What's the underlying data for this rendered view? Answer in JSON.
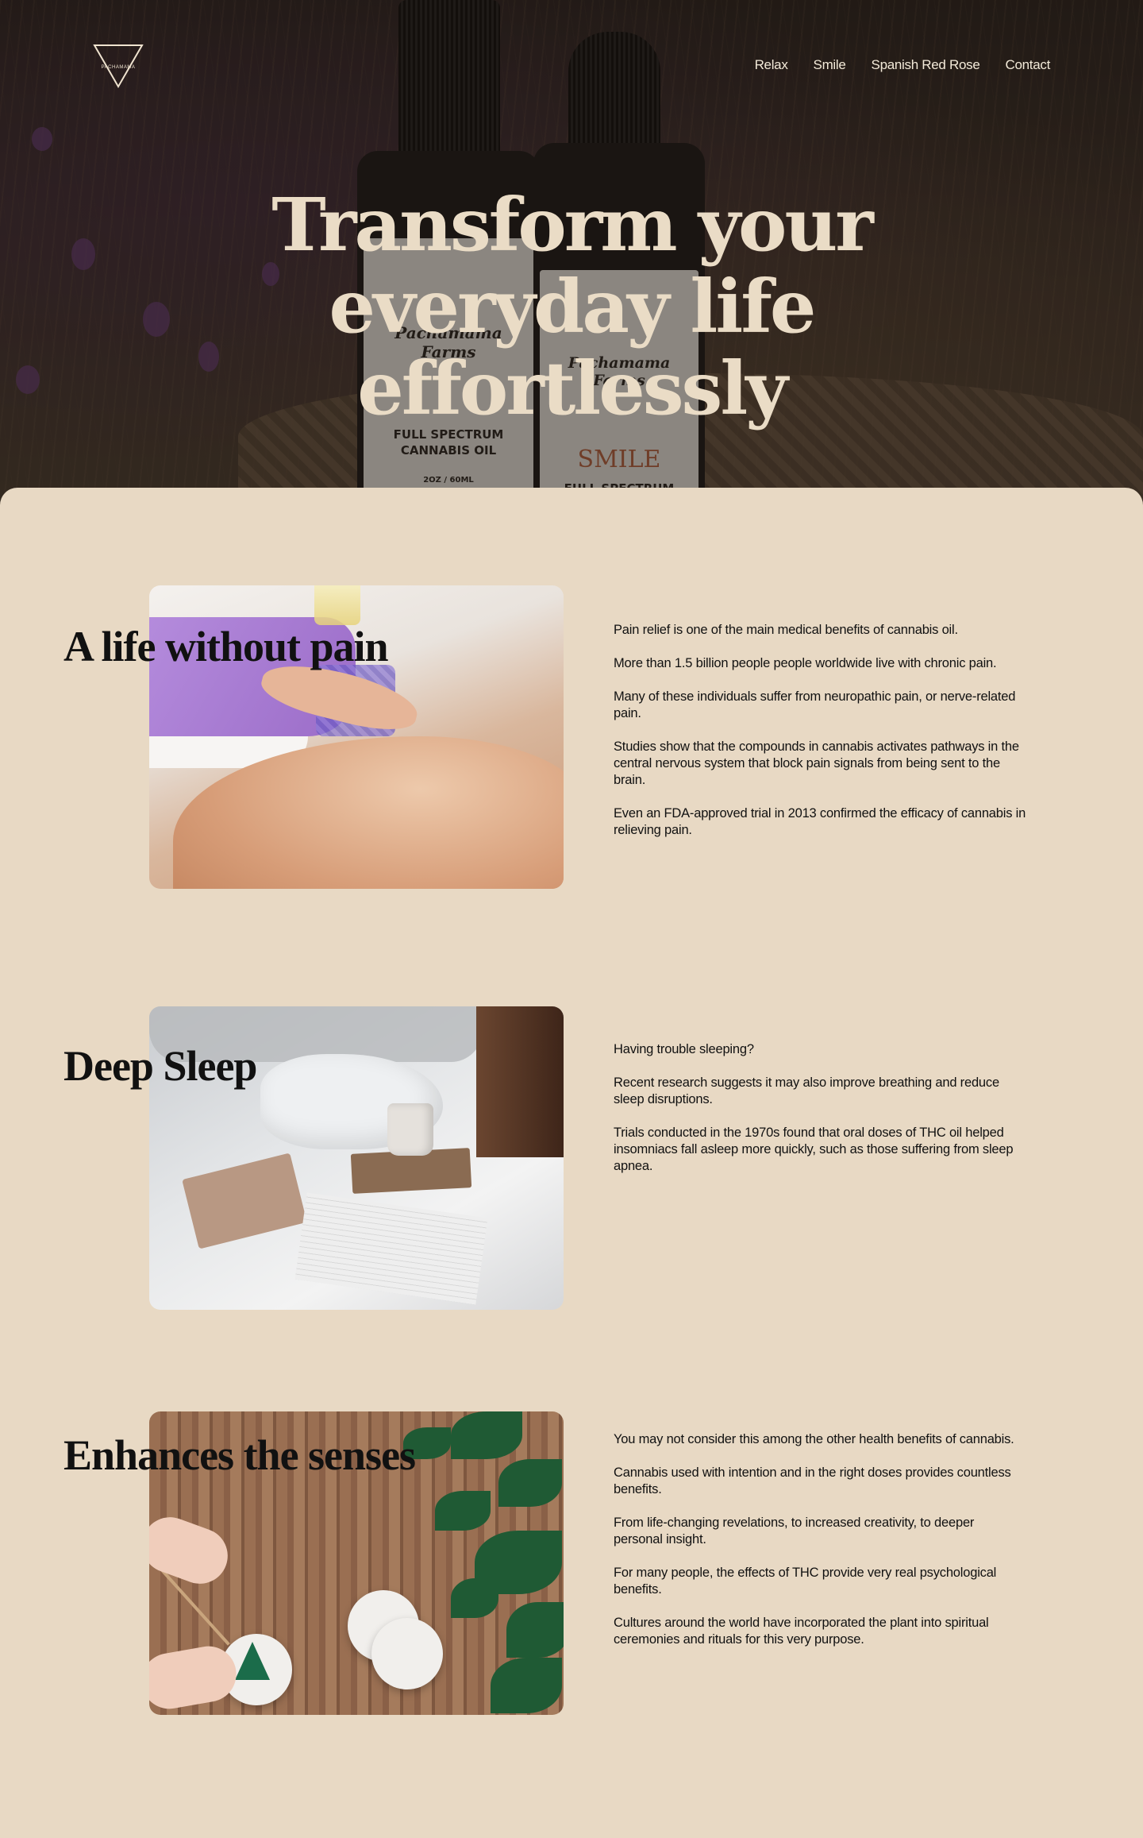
{
  "brand": {
    "logo_text": "PACHAMAMA"
  },
  "nav": {
    "items": [
      "Relax",
      "Smile",
      "Spanish Red Rose",
      "Contact"
    ]
  },
  "hero": {
    "title_lines": [
      "Transform your",
      "everyday life",
      "effortlessly"
    ],
    "bottle_left_label": [
      "Pachamama",
      "Farms",
      "FULL SPECTRUM",
      "CANNABIS OIL",
      "2OZ / 60ML"
    ],
    "bottle_right_label": [
      "Pachamama",
      "Farms",
      "SMILE",
      "FULL SPECTRUM"
    ]
  },
  "sections": [
    {
      "title": "A life without pain",
      "image": "massage-photo",
      "paragraphs": [
        "Pain relief is one of the main medical benefits of cannabis oil.",
        "More than 1.5 billion people people worldwide live with chronic pain.",
        "Many of these individuals suffer from neuropathic pain, or nerve-related pain.",
        "Studies show that the compounds in cannabis activates pathways in the central nervous system that block pain signals from being sent to the brain.",
        "Even an FDA-approved trial in 2013 confirmed the efficacy of cannabis in relieving pain."
      ]
    },
    {
      "title": "Deep Sleep",
      "image": "bed-photo",
      "paragraphs": [
        "Having trouble sleeping?",
        "Recent research suggests it may also improve breathing and reduce sleep disruptions.",
        "Trials conducted in the 1970s found that oral doses of THC oil helped insomniacs fall asleep more quickly, such as those suffering from sleep apnea."
      ]
    },
    {
      "title": "Enhances the senses",
      "image": "wood-table-photo",
      "paragraphs": [
        "You may not consider this among the other health benefits of cannabis.",
        "Cannabis used with intention and in the right doses provides countless benefits.",
        "From life-changing revelations, to increased creativity, to deeper personal insight.",
        "For many people, the effects of THC provide very real psychological benefits.",
        "Cultures around the world have incorporated the plant into spiritual ceremonies and rituals for this very purpose."
      ]
    }
  ],
  "colors": {
    "background": "#e8d9c4",
    "hero_text": "#eadcc6",
    "nav_text": "#f3ead9",
    "body_text": "#111111"
  }
}
